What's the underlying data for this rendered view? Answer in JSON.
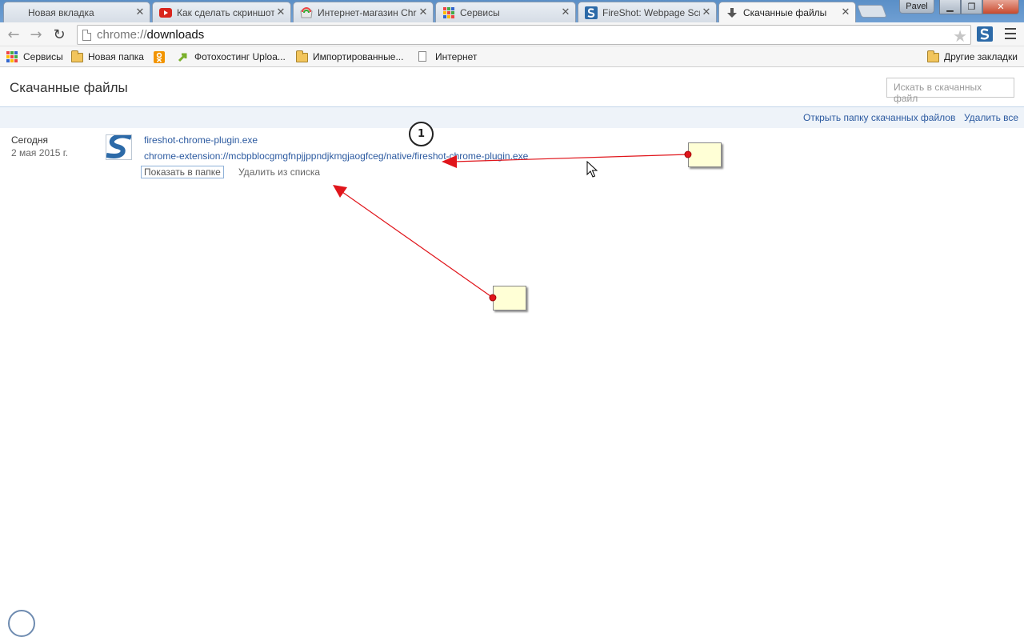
{
  "browser": {
    "tabs": [
      {
        "title": "Новая вкладка",
        "icon": "blank-tab-icon"
      },
      {
        "title": "Как сделать скриншот",
        "icon": "youtube-icon"
      },
      {
        "title": "Интернет-магазин Chr",
        "icon": "chrome-webstore-icon"
      },
      {
        "title": "Сервисы",
        "icon": "apps-icon"
      },
      {
        "title": "FireShot: Webpage Scr",
        "icon": "fireshot-icon"
      },
      {
        "title": "Скачанные файлы",
        "icon": "download-icon"
      }
    ],
    "close_glyph": "✕",
    "profile_name": "Pavel",
    "window_buttons": {
      "minimize": "▁",
      "maximize": "❐",
      "close": "✕"
    }
  },
  "toolbar": {
    "url_scheme": "chrome://",
    "url_host": "downloads",
    "back_glyph": "←",
    "forward_glyph": "→",
    "reload_glyph": "↻",
    "star_glyph": "★"
  },
  "bookmarks": {
    "items": [
      {
        "label": "Сервисы",
        "icon": "apps-icon"
      },
      {
        "label": "Новая папка",
        "icon": "folder-icon"
      },
      {
        "label": "",
        "icon": "odnoklassniki-icon"
      },
      {
        "label": "Фотохостинг Uploa...",
        "icon": "upload-icon"
      },
      {
        "label": "Импортированные...",
        "icon": "folder-icon"
      },
      {
        "label": "Интернет",
        "icon": "page-icon"
      }
    ],
    "other": "Другие закладки"
  },
  "page": {
    "title": "Скачанные файлы",
    "search_placeholder": "Искать в скачанных файл",
    "open_folder": "Открыть папку скачанных файлов",
    "clear_all": "Удалить все"
  },
  "downloads": [
    {
      "day": "Сегодня",
      "date": "2 мая 2015 г.",
      "file_name": "fireshot-chrome-plugin.exe",
      "url": "chrome-extension://mcbpblocgmgfnpjjppndjkmgjaogfceg/native/fireshot-chrome-plugin.exe",
      "show_in_folder": "Показать в папке",
      "remove": "Удалить из списка"
    }
  ],
  "annotations": {
    "step_number": "1",
    "arrow_color": "#e0151b"
  }
}
